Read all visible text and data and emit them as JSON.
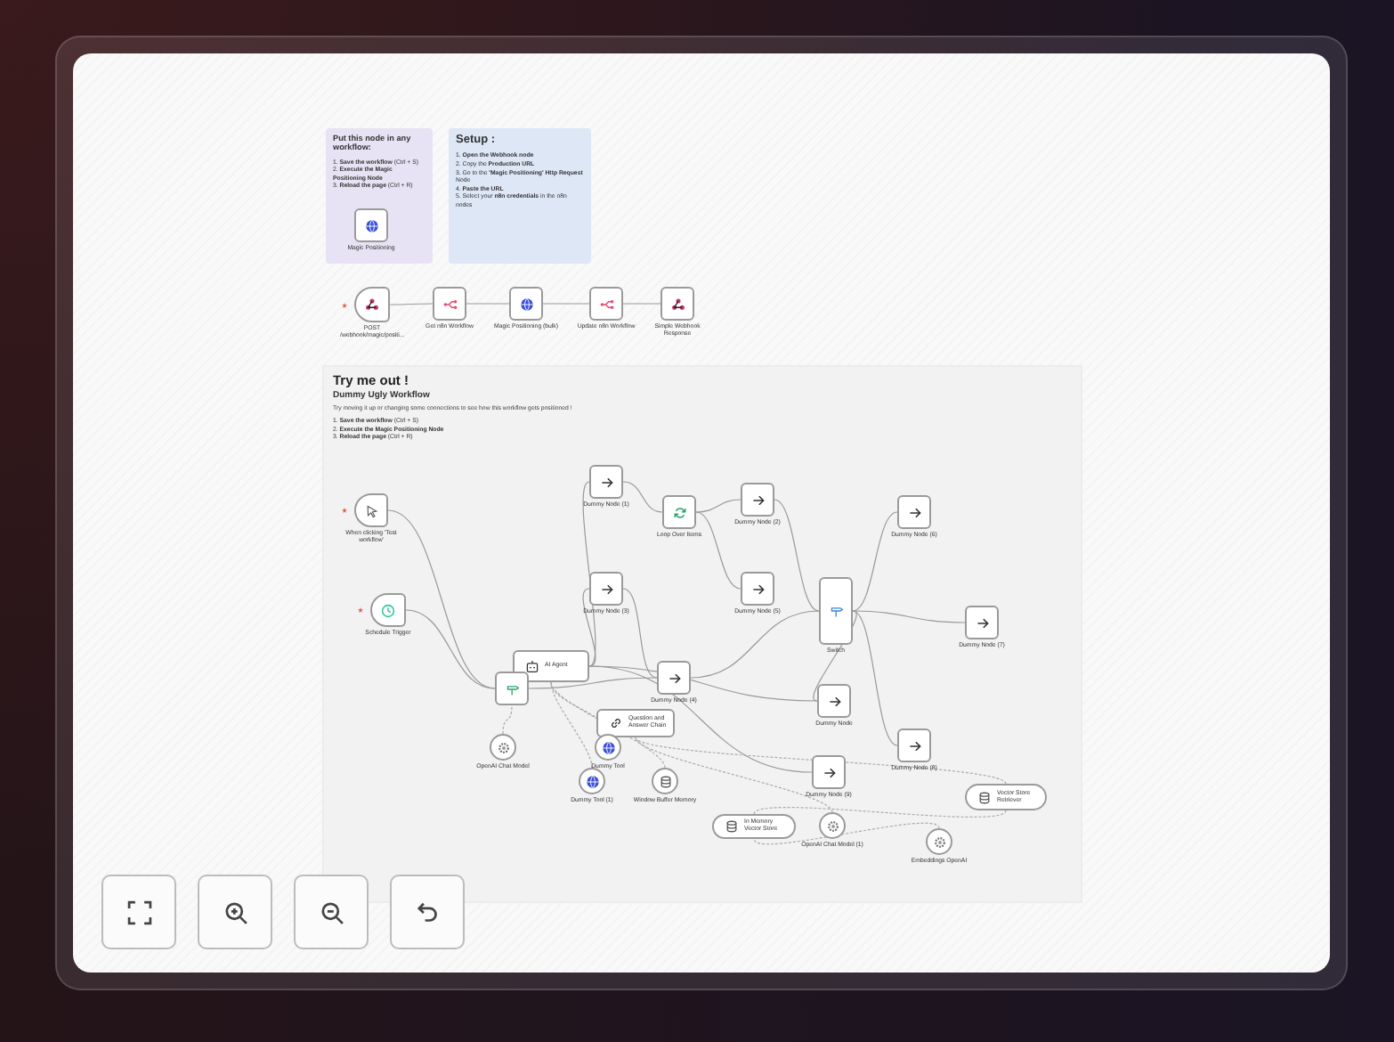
{
  "notes": [
    {
      "kind": "note_purple",
      "title": "Put this node in any workflow:",
      "steps": [
        "1. **Save the workflow** (Ctrl + S)",
        "2. **Execute the Magic Positioning Node**",
        "3. **Reload the page** (Ctrl + R)"
      ],
      "node": {
        "kind": "http",
        "label": "Magic Positioning"
      }
    },
    {
      "kind": "note_blue",
      "title": "Setup :",
      "steps": [
        "1. **Open the Webhook node**",
        "2. Copy the **Production URL**",
        "3. Go to the **'Magic Positioning' Http Request** Node",
        "4. **Paste the URL**",
        "5. Select your **n8n credentials** in the n8n nodes"
      ]
    }
  ],
  "setup_flow": [
    {
      "kind": "webhook",
      "label": "POST /webhook/magic/positi..."
    },
    {
      "kind": "n8n",
      "label": "Get n8n Workflow"
    },
    {
      "kind": "http",
      "label": "Magic Positioning (bulk)"
    },
    {
      "kind": "n8n",
      "label": "Update n8n Workflow"
    },
    {
      "kind": "respond",
      "label": "Simple Webhook Response"
    }
  ],
  "demo": {
    "title": "Try me out !",
    "subtitle": "Dummy Ugly Workflow",
    "description": "Try moving it up or changing some connections to see how this workflow gets positioned !",
    "steps": [
      "1. **Save the workflow** (Ctrl + S)",
      "2. **Execute the Magic Positioning Node**",
      "3. **Reload the page** (Ctrl + R)"
    ],
    "nodes": [
      {
        "kind": "manual_trigger",
        "label": "When clicking 'Test workflow'"
      },
      {
        "kind": "schedule_trigger",
        "label": "Schedule Trigger"
      },
      {
        "kind": "noop",
        "label": "Dummy Node (1)"
      },
      {
        "kind": "loop",
        "label": "Loop Over Items"
      },
      {
        "kind": "noop",
        "label": "Dummy Node (2)"
      },
      {
        "kind": "noop",
        "label": "Dummy Node (3)"
      },
      {
        "kind": "noop",
        "label": "Dummy Node (5)"
      },
      {
        "kind": "noop",
        "label": "Dummy Node (6)"
      },
      {
        "kind": "switch",
        "label": "Switch"
      },
      {
        "kind": "noop",
        "label": "Dummy Node (7)"
      },
      {
        "kind": "agent",
        "label": "AI Agent"
      },
      {
        "kind": "classifier"
      },
      {
        "kind": "noop",
        "label": "Dummy Node (4)"
      },
      {
        "kind": "chain",
        "label": "Question and Answer Chain"
      },
      {
        "kind": "noop",
        "label": "Dummy Node"
      },
      {
        "kind": "noop",
        "label": "Dummy Node (8)"
      },
      {
        "kind": "noop",
        "label": "Dummy Node (9)"
      },
      {
        "kind": "model",
        "label": "OpenAI Chat Model"
      },
      {
        "kind": "tool",
        "label": "Dummy Tool"
      },
      {
        "kind": "tool",
        "label": "Dummy Tool (1)"
      },
      {
        "kind": "memory",
        "label": "Window Buffer Memory"
      },
      {
        "kind": "vector_store",
        "label": "In Memory Vector Store"
      },
      {
        "kind": "model",
        "label": "OpenAI Chat Model (1)"
      },
      {
        "kind": "retriever",
        "label": "Vector Store Retriever"
      },
      {
        "kind": "embeddings",
        "label": "Embeddings OpenAI"
      }
    ]
  }
}
